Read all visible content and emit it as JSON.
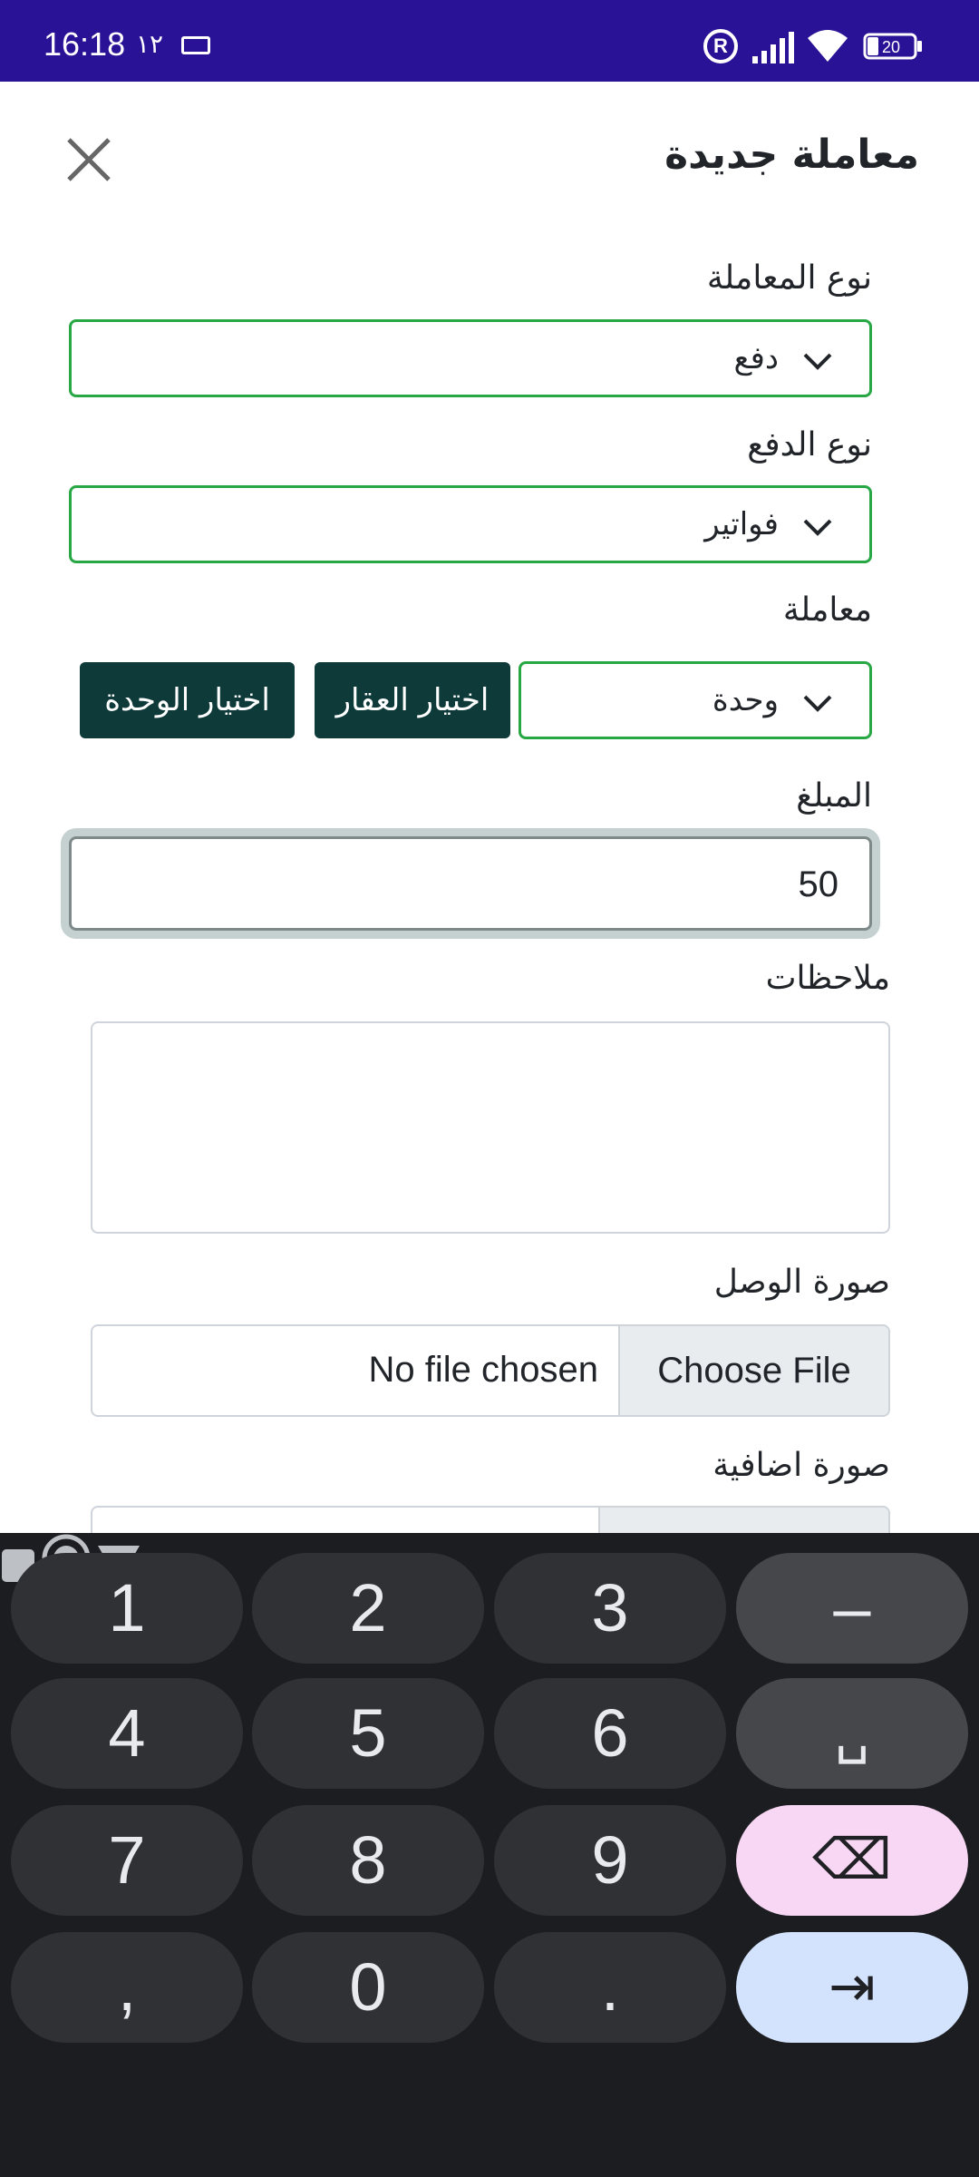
{
  "status_bar": {
    "time": "16:18",
    "time_arabic": "١٢",
    "battery": "20",
    "registered_mark": "R"
  },
  "header": {
    "title": "معاملة جديدة"
  },
  "form": {
    "transaction_type_label": "نوع المعاملة",
    "transaction_type_value": "دفع",
    "payment_type_label": "نوع الدفع",
    "payment_type_value": "فواتير",
    "transaction_label": "معاملة",
    "transaction_value": "وحدة",
    "choose_property_button": "اختيار العقار",
    "choose_unit_button": "اختيار الوحدة",
    "amount_label": "المبلغ",
    "amount_value": "50",
    "notes_label": "ملاحظات",
    "notes_value": "",
    "receipt_image_label": "صورة الوصل",
    "receipt_choose_file": "Choose File",
    "receipt_file_status": "No file chosen",
    "extra_image_label": "صورة اضافية"
  },
  "keyboard": {
    "keys": [
      "1",
      "2",
      "3",
      "–",
      "4",
      "5",
      "6",
      "␣",
      "7",
      "8",
      "9",
      "⌫",
      ",",
      "0",
      ".",
      "⇥"
    ]
  },
  "colors": {
    "status_bar": "#2a1297",
    "select_border": "#28a745",
    "dark_button": "#0e3a3a",
    "delete_key": "#f8d7f5",
    "enter_key": "#d3e3fd"
  }
}
